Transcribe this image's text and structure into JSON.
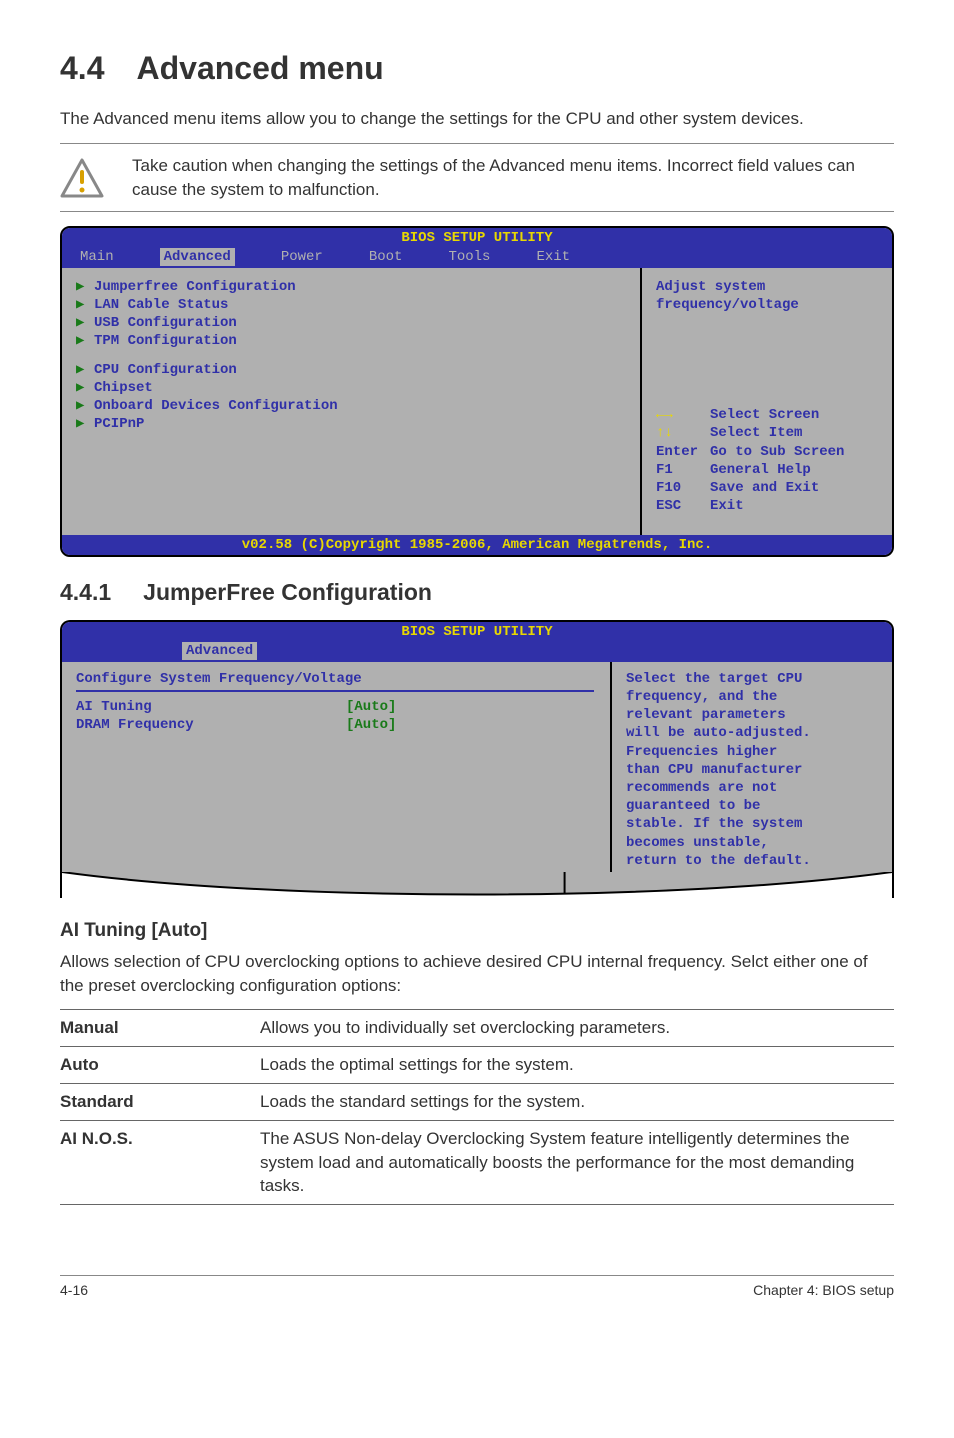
{
  "section": {
    "number": "4.4",
    "title": "Advanced menu"
  },
  "intro": "The Advanced menu items allow you to change the settings for the CPU and other system devices.",
  "caution": "Take caution when changing the settings of the Advanced menu items. Incorrect field values can cause the system to malfunction.",
  "bios1": {
    "title": "BIOS SETUP UTILITY",
    "menus": [
      "Main",
      "Advanced",
      "Power",
      "Boot",
      "Tools",
      "Exit"
    ],
    "selectedMenu": "Advanced",
    "group1": [
      "Jumperfree Configuration",
      "LAN Cable Status",
      "USB Configuration",
      "TPM Configuration"
    ],
    "group2": [
      "CPU Configuration",
      "Chipset",
      "Onboard Devices Configuration",
      "PCIPnP"
    ],
    "hint1": "Adjust system",
    "hint2": "frequency/voltage",
    "keys": [
      {
        "k": "←→",
        "v": "Select Screen"
      },
      {
        "k": "↑↓",
        "v": "Select Item"
      },
      {
        "k": "Enter",
        "v": "Go to Sub Screen"
      },
      {
        "k": "F1",
        "v": "General Help"
      },
      {
        "k": "F10",
        "v": "Save and Exit"
      },
      {
        "k": "ESC",
        "v": "Exit"
      }
    ],
    "footer": "v02.58 (C)Copyright 1985-2006, American Megatrends, Inc."
  },
  "subsection": {
    "number": "4.4.1",
    "title": "JumperFree Configuration"
  },
  "bios2": {
    "title": "BIOS SETUP UTILITY",
    "selectedMenu": "Advanced",
    "header": "Configure System Frequency/Voltage",
    "items": [
      {
        "label": "AI Tuning",
        "value": "[Auto]"
      },
      {
        "label": "DRAM Frequency",
        "value": "[Auto]"
      }
    ],
    "help": [
      "Select the target CPU",
      "frequency, and the",
      "relevant parameters",
      "will be auto-adjusted.",
      "Frequencies higher",
      "than CPU manufacturer",
      "recommends are not",
      "guaranteed to be",
      "stable. If the system",
      "becomes unstable,",
      "return to the default."
    ]
  },
  "aiTuning": {
    "heading": "AI Tuning [Auto]",
    "desc": "Allows selection of CPU overclocking options to achieve desired CPU internal frequency. Selct either one of the preset overclocking configuration options:",
    "rows": [
      {
        "k": "Manual",
        "v": "Allows you to individually set overclocking parameters."
      },
      {
        "k": "Auto",
        "v": "Loads the optimal settings for the system."
      },
      {
        "k": "Standard",
        "v": "Loads the standard settings for the system."
      },
      {
        "k": "AI N.O.S.",
        "v": "The ASUS Non-delay Overclocking System feature intelligently determines the system load and automatically boosts the performance for the most demanding tasks."
      }
    ]
  },
  "footer": {
    "left": "4-16",
    "right": "Chapter 4: BIOS setup"
  }
}
